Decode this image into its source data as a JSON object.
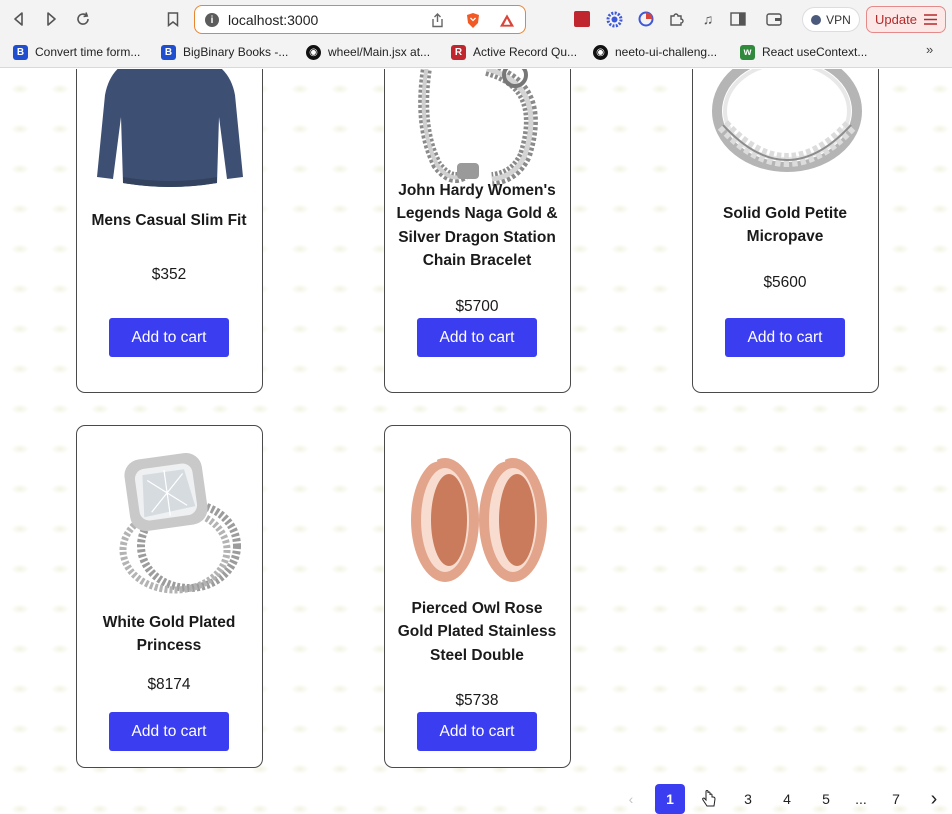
{
  "browser": {
    "url": "localhost:3000",
    "vpn_label": "VPN",
    "update_label": "Update",
    "bookmarks": [
      {
        "label": "Convert time form...",
        "icon": "bigbinary-icon",
        "color": "#1f4fcf"
      },
      {
        "label": "BigBinary Books -...",
        "icon": "bigbinary-icon",
        "color": "#1f4fcf"
      },
      {
        "label": "wheel/Main.jsx at...",
        "icon": "github-icon",
        "color": "#111111"
      },
      {
        "label": "Active Record Qu...",
        "icon": "rails-icon",
        "color": "#c0262e"
      },
      {
        "label": "neeto-ui-challeng...",
        "icon": "github-icon",
        "color": "#111111"
      },
      {
        "label": "React useContext...",
        "icon": "w3-icon",
        "color": "#2f8a3b"
      }
    ],
    "bookmarks_more": "»"
  },
  "products": [
    {
      "title": "Mens Casual Slim Fit",
      "price": "$352",
      "button": "Add to cart",
      "image": "sweater-image"
    },
    {
      "title": "John Hardy Women's Legends Naga Gold & Silver Dragon Station Chain Bracelet",
      "price": "$5700",
      "button": "Add to cart",
      "image": "bracelet-image"
    },
    {
      "title": "Solid Gold Petite Micropave",
      "price": "$5600",
      "button": "Add to cart",
      "image": "ring-image"
    },
    {
      "title": "White Gold Plated Princess",
      "price": "$8174",
      "button": "Add to cart",
      "image": "diamond-ring-image"
    },
    {
      "title": "Pierced Owl Rose Gold Plated Stainless Steel Double",
      "price": "$5738",
      "button": "Add to cart",
      "image": "rose-gold-tunnels-image"
    }
  ],
  "pagination": {
    "prev": "‹",
    "next": "›",
    "current": "1",
    "pages": [
      "1",
      "2",
      "3",
      "4",
      "5",
      "...",
      "7"
    ]
  },
  "colors": {
    "accent": "#3b3df0",
    "card_border": "#4a4a4a",
    "url_focus": "#e9842f"
  }
}
